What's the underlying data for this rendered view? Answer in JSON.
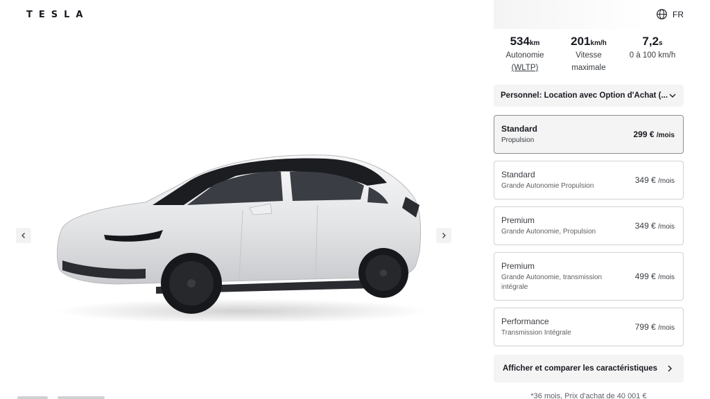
{
  "brand": {
    "logo": "TESLA"
  },
  "header": {
    "language": "FR",
    "language_icon": "globe-icon"
  },
  "viewer": {
    "prev_icon": "chevron-left-icon",
    "next_icon": "chevron-right-icon"
  },
  "specs": [
    {
      "value": "534",
      "unit": "km",
      "label_line1": "Autonomie",
      "label_line2": "(WLTP)"
    },
    {
      "value": "201",
      "unit": "km/h",
      "label_line1": "Vitesse",
      "label_line2": "maximale"
    },
    {
      "value": "7,2",
      "unit": "s",
      "label_line1": "0 à 100 km/h",
      "label_line2": ""
    }
  ],
  "finance": {
    "label": "Personnel: Location avec Option d'Achat (...",
    "icon": "chevron-down-icon"
  },
  "trims": [
    {
      "name": "Standard",
      "sub": "Propulsion",
      "price": "299 €",
      "per": "/mois",
      "selected": true
    },
    {
      "name": "Standard",
      "sub": "Grande Autonomie Propulsion",
      "price": "349 €",
      "per": "/mois",
      "selected": false
    },
    {
      "name": "Premium",
      "sub": "Grande Autonomie, Propulsion",
      "price": "349 €",
      "per": "/mois",
      "selected": false
    },
    {
      "name": "Premium",
      "sub": "Grande Autonomie, transmission intégrale",
      "price": "499 €",
      "per": "/mois",
      "selected": false
    },
    {
      "name": "Performance",
      "sub": "Transmission Intégrale",
      "price": "799 €",
      "per": "/mois",
      "selected": false
    }
  ],
  "compare": {
    "label": "Afficher et comparer les caractéristiques",
    "icon": "chevron-right-icon"
  },
  "footnote": "*36 mois, Prix d'achat de 40 001 €"
}
